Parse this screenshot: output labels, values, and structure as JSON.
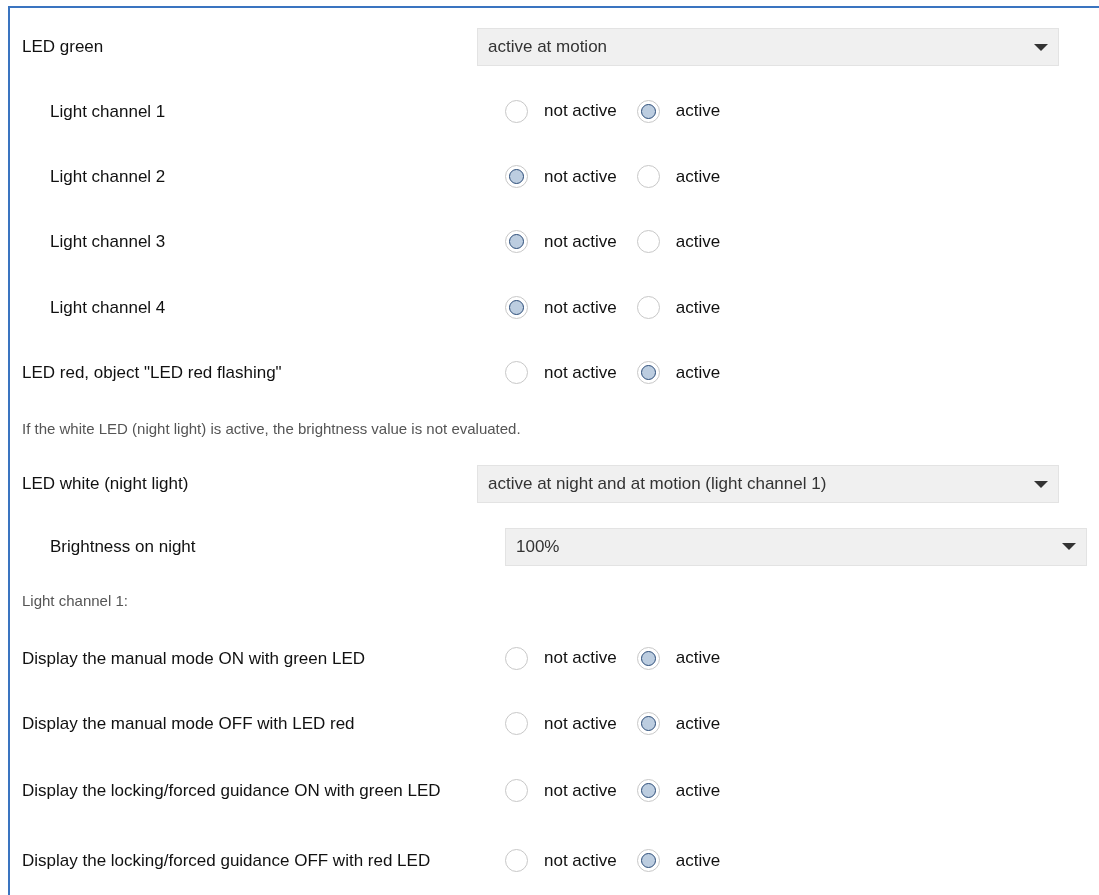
{
  "rows": [
    {
      "kind": "dropdown",
      "label": "LED green",
      "value": "active at motion",
      "children": [
        {
          "kind": "radio",
          "label": "Light channel 1",
          "options": [
            {
              "label": "not active",
              "selected": false
            },
            {
              "label": "active",
              "selected": true
            }
          ]
        },
        {
          "kind": "radio",
          "label": "Light channel 2",
          "options": [
            {
              "label": "not active",
              "selected": true
            },
            {
              "label": "active",
              "selected": false
            }
          ]
        },
        {
          "kind": "radio",
          "label": "Light channel 3",
          "options": [
            {
              "label": "not active",
              "selected": true
            },
            {
              "label": "active",
              "selected": false
            }
          ]
        },
        {
          "kind": "radio",
          "label": "Light channel 4",
          "options": [
            {
              "label": "not active",
              "selected": true
            },
            {
              "label": "active",
              "selected": false
            }
          ]
        }
      ]
    },
    {
      "kind": "radio",
      "label": "LED red, object \"LED red flashing\"",
      "options": [
        {
          "label": "not active",
          "selected": false
        },
        {
          "label": "active",
          "selected": true
        }
      ]
    },
    {
      "kind": "note",
      "label": "If the white LED (night light) is active, the brightness value is not evaluated."
    },
    {
      "kind": "dropdown",
      "label": "LED white (night light)",
      "value": "active at night and at motion (light channel 1)",
      "children": [
        {
          "kind": "dropdown",
          "label": "Brightness on night",
          "value": "100%"
        }
      ]
    },
    {
      "kind": "note",
      "label": "Light channel 1:"
    },
    {
      "kind": "radio",
      "label": "Display the manual mode ON with green LED",
      "options": [
        {
          "label": "not active",
          "selected": false
        },
        {
          "label": "active",
          "selected": true
        }
      ]
    },
    {
      "kind": "radio",
      "label": "Display the manual mode OFF with LED red",
      "options": [
        {
          "label": "not active",
          "selected": false
        },
        {
          "label": "active",
          "selected": true
        }
      ]
    },
    {
      "kind": "radio",
      "label": "Display the locking/forced guidance ON with green LED",
      "options": [
        {
          "label": "not active",
          "selected": false
        },
        {
          "label": "active",
          "selected": true
        }
      ]
    },
    {
      "kind": "radio",
      "label": "Display the locking/forced guidance OFF with red LED",
      "options": [
        {
          "label": "not active",
          "selected": false
        },
        {
          "label": "active",
          "selected": true
        }
      ]
    }
  ]
}
